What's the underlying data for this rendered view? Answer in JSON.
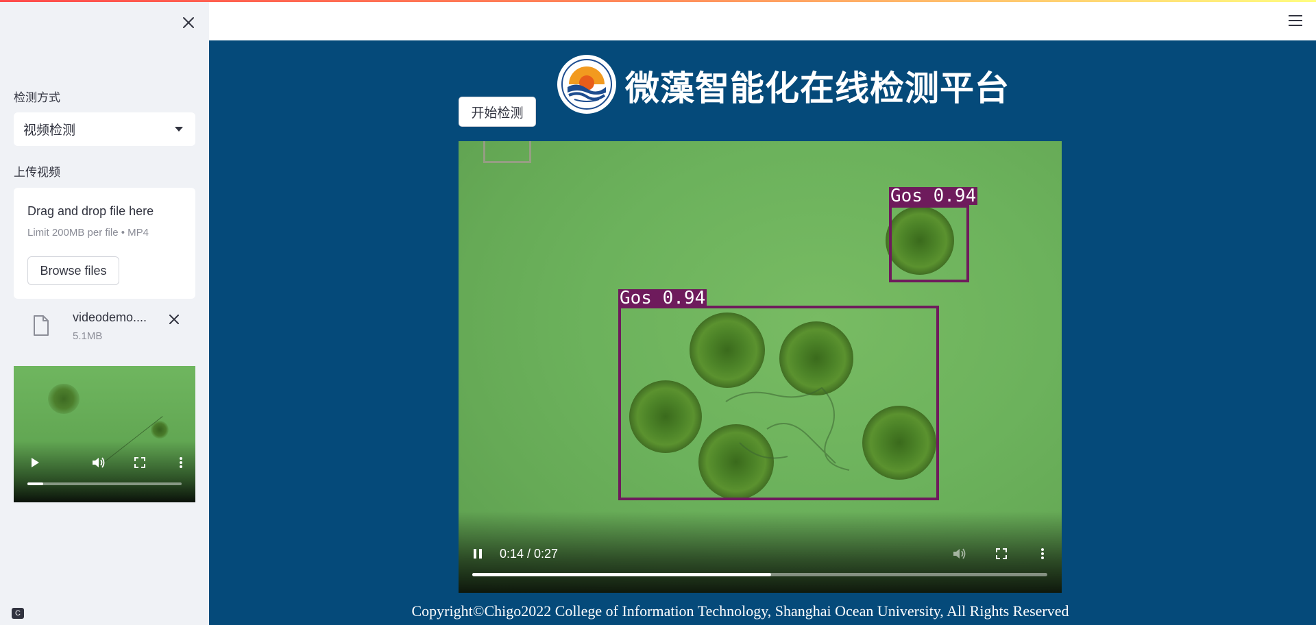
{
  "sidebar": {
    "detect_mode_label": "检测方式",
    "detect_mode_value": "视频检测",
    "upload_label": "上传视频",
    "dropzone": {
      "title": "Drag and drop file here",
      "limit": "Limit 200MB per file • MP4",
      "browse_label": "Browse files"
    },
    "file": {
      "name": "videodemo....",
      "size": "5.1MB"
    },
    "thumb_player": {
      "progress": 0.1
    }
  },
  "main": {
    "title": "微藻智能化在线检测平台",
    "start_button": "开始检测",
    "video": {
      "detections": [
        {
          "label": "Gos 0.94"
        },
        {
          "label": "Gos 0.94"
        }
      ],
      "time": "0:14 / 0:27",
      "progress": 0.52
    },
    "footer": "Copyright©Chigo2022 College of Information Technology, Shanghai Ocean University, All Rights Reserved"
  },
  "colors": {
    "main_bg": "#054a7a",
    "sidebar_bg": "#f0f2f6",
    "bbox": "#6e1b5c"
  },
  "icons": [
    "close-icon",
    "caret-down-icon",
    "file-icon",
    "play-icon",
    "volume-icon",
    "fullscreen-icon",
    "more-icon",
    "pause-icon",
    "hamburger-icon",
    "university-logo"
  ]
}
